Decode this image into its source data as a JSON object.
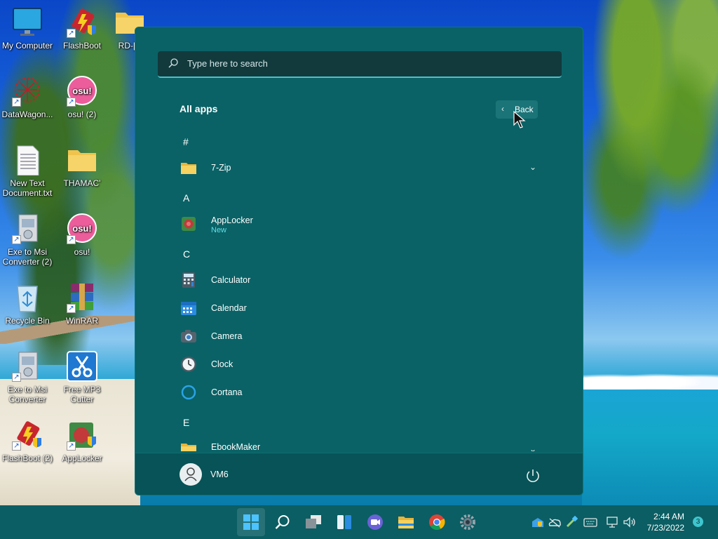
{
  "desktop": {
    "icons": [
      {
        "label": "My Computer"
      },
      {
        "label": "FlashBoot"
      },
      {
        "label": "RD-[E"
      },
      {
        "label": "DataWagon..."
      },
      {
        "label": "osu! (2)"
      },
      {
        "label": "New Text Document.txt"
      },
      {
        "label": "THAMAC'"
      },
      {
        "label": "Exe to Msi Converter (2)"
      },
      {
        "label": "osu!"
      },
      {
        "label": "Recycle Bin"
      },
      {
        "label": "WinRAR"
      },
      {
        "label": "Exe to Msi Converter"
      },
      {
        "label": "Free MP3 Cutter"
      },
      {
        "label": "FlashBoot (2)"
      },
      {
        "label": "AppLocker"
      }
    ],
    "osu_badge": "osu!"
  },
  "start_menu": {
    "search_placeholder": "Type here to search",
    "all_apps_title": "All apps",
    "back_label": "Back",
    "sections": [
      {
        "letter": "#",
        "apps": [
          {
            "name": "7-Zip",
            "icon": "folder-icon",
            "expandable": true
          }
        ]
      },
      {
        "letter": "A",
        "apps": [
          {
            "name": "AppLocker",
            "badge": "New",
            "icon": "applocker-icon"
          }
        ]
      },
      {
        "letter": "C",
        "apps": [
          {
            "name": "Calculator",
            "icon": "calculator-icon"
          },
          {
            "name": "Calendar",
            "icon": "calendar-icon"
          },
          {
            "name": "Camera",
            "icon": "camera-icon"
          },
          {
            "name": "Clock",
            "icon": "clock-icon"
          },
          {
            "name": "Cortana",
            "icon": "cortana-icon"
          }
        ]
      },
      {
        "letter": "E",
        "apps": [
          {
            "name": "EbookMaker",
            "icon": "folder-icon",
            "expandable": true
          }
        ]
      }
    ],
    "user_name": "VM6"
  },
  "taskbar": {
    "apps": [
      "start-icon",
      "search-icon",
      "task-view-icon",
      "widgets-icon",
      "teams-chat-icon",
      "file-explorer-icon",
      "chrome-icon",
      "settings-icon"
    ],
    "time": "2:44 AM",
    "date": "7/23/2022",
    "notification_count": "3"
  },
  "colors": {
    "menu_bg": "#0a6266",
    "taskbar_bg": "#0b5e63",
    "accent": "#4ec1c9",
    "new_badge": "#5ee0e8"
  }
}
